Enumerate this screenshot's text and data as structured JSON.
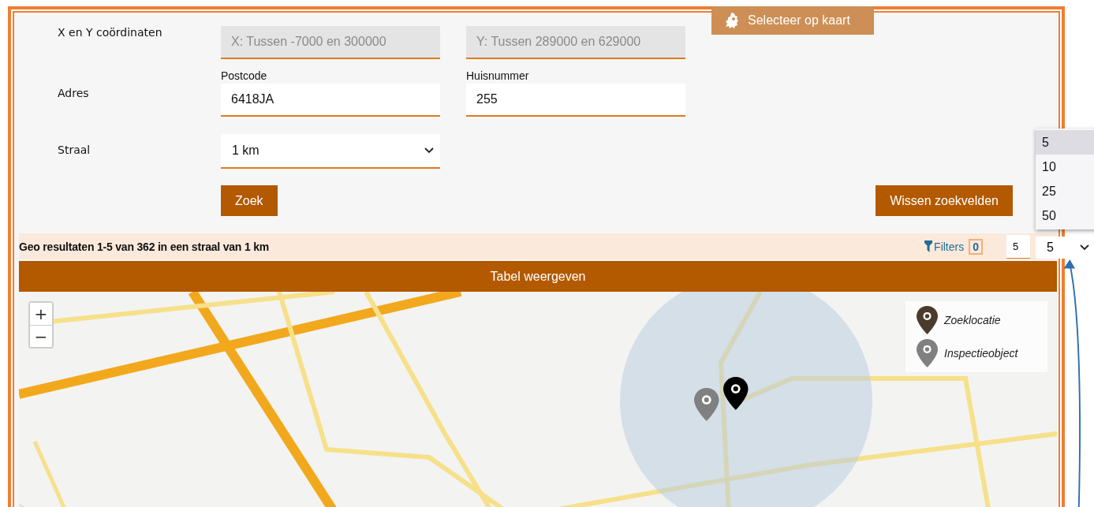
{
  "coordinates": {
    "label": "X en Y coördinaten",
    "x_field": {
      "placeholder": "X: Tussen -7000 en 300000",
      "disabled": true
    },
    "y_field": {
      "placeholder": "Y: Tussen 289000 en 629000",
      "disabled": true
    },
    "map_button": "Selecteer op kaart"
  },
  "address": {
    "label": "Adres",
    "postcode": {
      "label": "Postcode",
      "value": "6418JA"
    },
    "house_number": {
      "label": "Huisnummer",
      "value": "255"
    }
  },
  "radius": {
    "label": "Straal",
    "value": "1 km"
  },
  "search_button": "Zoek",
  "clear_button": "Wissen zoekvelden",
  "results": {
    "summary": "Geo resultaten 1-5 van 362 in een straal van 1 km",
    "filters_label": "Filters",
    "filters_count": "0",
    "page_input": "5",
    "page_size": {
      "value": "5",
      "expanded": true,
      "options": [
        {
          "label": "5",
          "selected": true
        },
        {
          "label": "10",
          "selected": false
        },
        {
          "label": "25",
          "selected": false
        },
        {
          "label": "50",
          "selected": false
        }
      ]
    }
  },
  "table_toggle": "Tabel weergeven",
  "map": {
    "zoom_in": "+",
    "zoom_out": "−",
    "legend": [
      {
        "label": "Zoeklocatie",
        "color": "#4b3b2b"
      },
      {
        "label": "Inspectieobject",
        "color": "#808080"
      }
    ]
  }
}
